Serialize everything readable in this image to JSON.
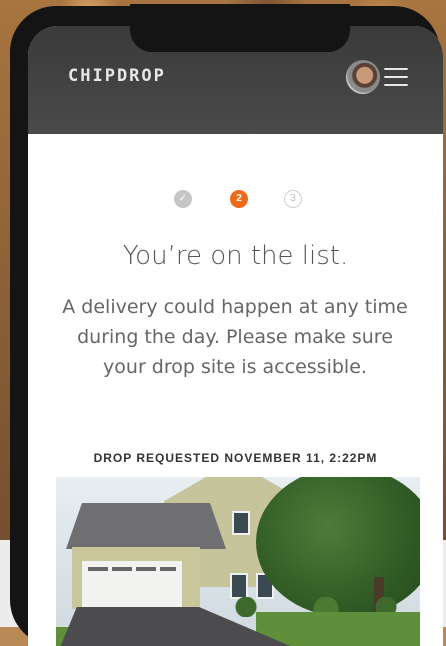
{
  "app": {
    "brand": "CHIPDROP",
    "accent_color": "#ef6a1a",
    "header_color": "#3f3f3f"
  },
  "header": {
    "menu_icon": "hamburger-menu-icon",
    "avatar_icon": "user-avatar"
  },
  "steps": [
    {
      "label": "",
      "state": "complete",
      "icon": "check-icon"
    },
    {
      "label": "2",
      "state": "current"
    },
    {
      "label": "3",
      "state": "upcoming"
    }
  ],
  "main": {
    "title": "You’re on the list.",
    "message": "A delivery could happen at any time during the day. Please make sure your drop site is accessible.",
    "drop_label": "DROP REQUESTED NOVEMBER 11, 2:22PM"
  },
  "photo": {
    "subject": "house-photo"
  }
}
